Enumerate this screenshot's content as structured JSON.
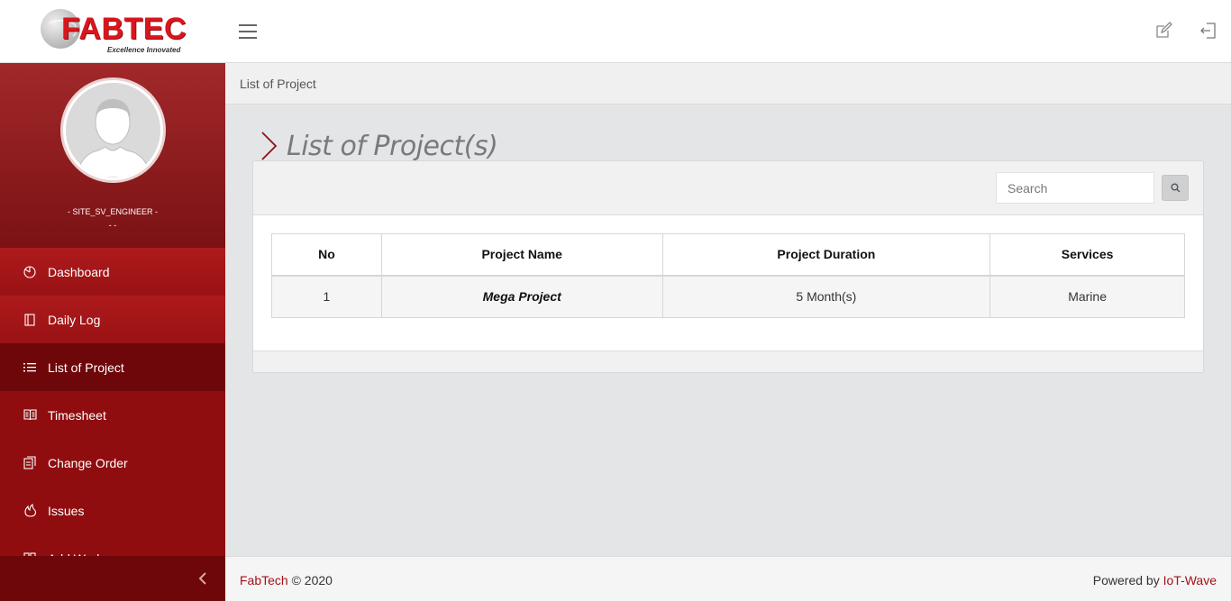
{
  "header": {
    "logo_text": "FABTEC",
    "logo_tagline": "Excellence Innovated",
    "menu_icon": "hamburger-icon",
    "actions": [
      {
        "icon": "edit-icon"
      },
      {
        "icon": "logout-icon"
      }
    ]
  },
  "sidebar": {
    "user_role": "- SITE_SV_ENGINEER -",
    "user_sub": "- -",
    "items": [
      {
        "label": "Dashboard",
        "icon": "dashboard-icon"
      },
      {
        "label": "Daily Log",
        "icon": "notebook-icon"
      },
      {
        "label": "List of Project",
        "icon": "list-icon",
        "active": true
      },
      {
        "label": "Timesheet",
        "icon": "book-icon"
      },
      {
        "label": "Change Order",
        "icon": "clipboard-icon"
      },
      {
        "label": "Issues",
        "icon": "fire-icon"
      },
      {
        "label": "Add Work",
        "icon": "grid-icon"
      }
    ],
    "collapse_icon": "chevron-left-icon"
  },
  "breadcrumb": "List of Project",
  "page_title": "List of Project(s)",
  "search": {
    "placeholder": "Search",
    "value": ""
  },
  "table": {
    "columns": [
      "No",
      "Project Name",
      "Project Duration",
      "Services"
    ],
    "rows": [
      {
        "no": "1",
        "project_name": "Mega Project",
        "duration": "5 Month(s)",
        "services": "Marine"
      }
    ]
  },
  "footer": {
    "brand": "FabTech",
    "copyright": "© 2020",
    "powered_by": "Powered by",
    "powered_brand": "IoT-Wave"
  },
  "colors": {
    "brand_red": "#d9161e",
    "sidebar_red": "#8d0b0e",
    "active_item": "#6e0709"
  }
}
